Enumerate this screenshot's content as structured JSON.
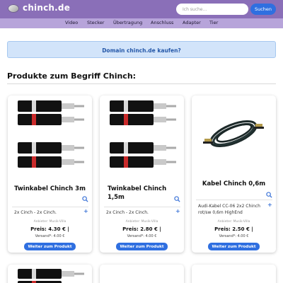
{
  "header": {
    "site_name": "chinch.de",
    "search_placeholder": "Ich suche...",
    "search_button": "Suchen",
    "logo_icon": "sphere-logo-icon"
  },
  "nav": {
    "items": [
      "Video",
      "Stecker",
      "Übertragung",
      "Anschluss",
      "Adapter",
      "Tier"
    ]
  },
  "domain_banner": {
    "label": "Domain chinch.de kaufen?"
  },
  "section": {
    "title": "Produkte zum Begriff Chinch:"
  },
  "colors": {
    "header_bg": "#8a6fb8",
    "nav_bg": "#b7a4da",
    "accent": "#2f6fe0",
    "banner_bg": "#d2e4fa",
    "banner_text": "#2457a8"
  },
  "products": [
    {
      "title_line1": "Twinkabel Chinch 3m",
      "title_line2": "",
      "image": "rca-twin-cable-photo",
      "description_line1": "2x Cinch - 2x Cinch.",
      "description_line2": "",
      "seller": "Anbieter: Musik-Villa",
      "price": "Preis: 4.30 € |",
      "shipping": "Versand*: 4.00 €",
      "button": "Weiter zum Produkt"
    },
    {
      "title_line1": "Twinkabel Chinch",
      "title_line2": "1,5m",
      "image": "rca-twin-cable-photo",
      "description_line1": "2x Cinch - 2x Cinch.",
      "description_line2": "",
      "seller": "Anbieter: Musik-Villa",
      "price": "Preis: 2.80 € |",
      "shipping": "Versand*: 4.00 €",
      "button": "Weiter zum Produkt"
    },
    {
      "title_line1": "Kabel Chinch 0,6m",
      "title_line2": "",
      "image": "coiled-audio-cable-photo",
      "description_line1": "Audi-Kabel CC-06 2x2 Chinch",
      "description_line2": "rot/sw 0,6m HighEnd",
      "seller": "Anbieter: Musik-Villa",
      "price": "Preis: 2.50 € |",
      "shipping": "Versand*: 4.00 €",
      "button": "Weiter zum Produkt"
    }
  ],
  "icons": {
    "zoom": "magnifier-icon",
    "expand": "plus-icon"
  }
}
